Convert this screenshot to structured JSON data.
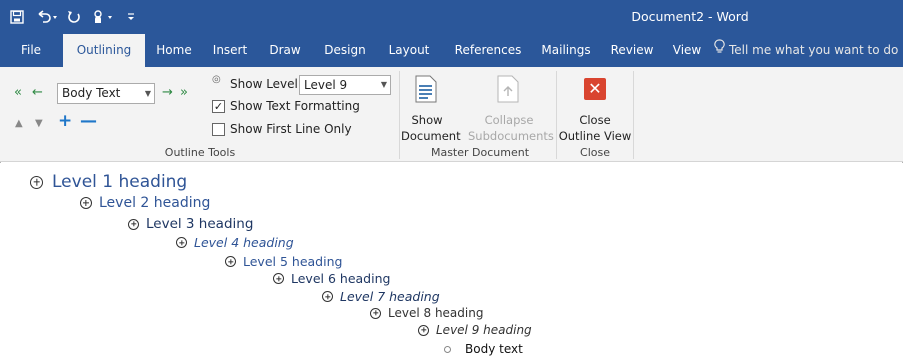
{
  "titlebar": {
    "save_icon": "save-icon",
    "undo_icon": "undo-icon",
    "redo_icon": "redo-icon",
    "touch_icon": "touch-mode-icon",
    "customize_icon": "customize-qat-icon",
    "document_title": "Document2  -  Word",
    "bg_color": "#2b579a"
  },
  "tabs": [
    {
      "label": "File"
    },
    {
      "label": "Outlining",
      "active": true
    },
    {
      "label": "Home"
    },
    {
      "label": "Insert"
    },
    {
      "label": "Draw"
    },
    {
      "label": "Design"
    },
    {
      "label": "Layout"
    },
    {
      "label": "References"
    },
    {
      "label": "Mailings"
    },
    {
      "label": "Review"
    },
    {
      "label": "View"
    }
  ],
  "tell_me": {
    "icon": "lightbulb-icon",
    "text": "Tell me what you want to do"
  },
  "outline_tools": {
    "level_select_value": "Body Text",
    "show_level_label": "Show Level:",
    "show_level_value": "Level 9",
    "show_text_formatting_label": "Show Text Formatting",
    "show_text_formatting_checked": true,
    "show_first_line_label": "Show First Line Only",
    "show_first_line_checked": false,
    "group_label": "Outline Tools"
  },
  "master_document": {
    "show_document_line1": "Show",
    "show_document_line2": "Document",
    "collapse_line1": "Collapse",
    "collapse_line2": "Subdocuments",
    "group_label": "Master Document"
  },
  "close_group": {
    "close_line1": "Close",
    "close_line2": "Outline View",
    "group_label": "Close",
    "close_color": "#d9442f"
  },
  "outline": [
    {
      "text": "Level 1 heading",
      "level": 1
    },
    {
      "text": "Level 2 heading",
      "level": 2
    },
    {
      "text": "Level 3 heading",
      "level": 3
    },
    {
      "text": "Level 4 heading",
      "level": 4
    },
    {
      "text": "Level 5 heading",
      "level": 5
    },
    {
      "text": "Level 6 heading",
      "level": 6
    },
    {
      "text": "Level 7 heading",
      "level": 7
    },
    {
      "text": "Level 8 heading",
      "level": 8
    },
    {
      "text": "Level 9 heading",
      "level": 9
    },
    {
      "text": "Body text",
      "level": 10
    }
  ]
}
